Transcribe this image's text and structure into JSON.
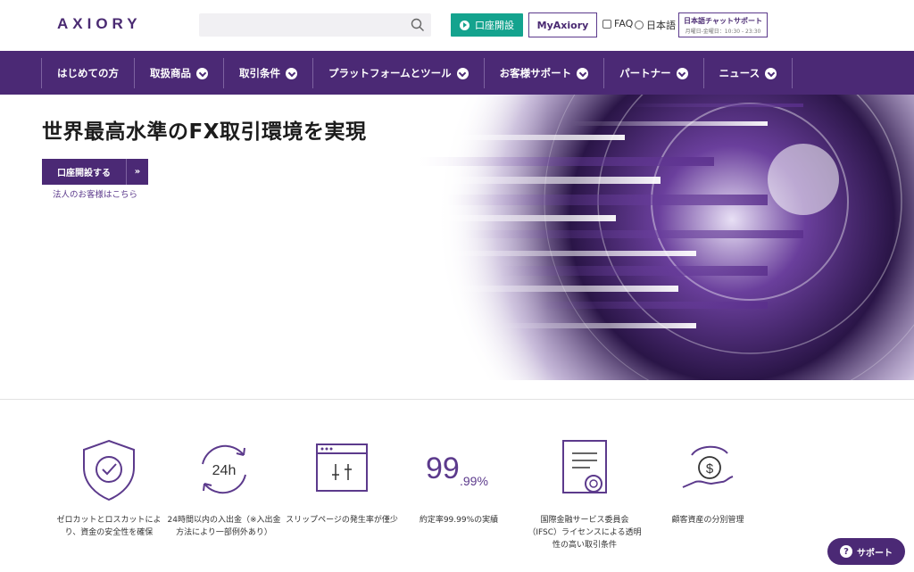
{
  "header": {
    "logo": "AXIORY",
    "search_placeholder": "",
    "open_account": "口座開設",
    "myaxiory": "MyAxiory",
    "faq": "FAQ",
    "language": "日本語",
    "chat_title": "日本語チャットサポート",
    "chat_hours": "月曜日-金曜日：10:30 - 23:30"
  },
  "nav": {
    "items": [
      {
        "label": "はじめての方"
      },
      {
        "label": "取扱商品"
      },
      {
        "label": "取引条件"
      },
      {
        "label": "プラットフォームとツール"
      },
      {
        "label": "お客様サポート"
      },
      {
        "label": "パートナー"
      },
      {
        "label": "ニュース"
      }
    ]
  },
  "hero": {
    "headline": "世界最高水準のFX取引環境を実現",
    "cta": "口座開設する",
    "cta_arrow": "»",
    "corporate_link": "法人のお客様はこちら"
  },
  "features": [
    {
      "icon": "shield-check-icon",
      "caption": "ゼロカットとロスカットにより、資金の安全性を確保"
    },
    {
      "icon": "24h-clock-icon",
      "icon_text": "24h",
      "caption": "24時間以内の入出金（※入出金方法により一部例外あり）"
    },
    {
      "icon": "browser-sliders-icon",
      "caption": "スリップページの発生率が僅少"
    },
    {
      "icon": "percentage-icon",
      "icon_text_big": "99",
      "icon_text_small": ".99%",
      "caption": "約定率99.99%の実績"
    },
    {
      "icon": "certificate-icon",
      "caption": "国際金融サービス委員会（IFSC）ライセンスによる透明性の高い取引条件"
    },
    {
      "icon": "hand-coin-icon",
      "caption": "顧客資産の分別管理"
    }
  ],
  "support_button": "サポート",
  "colors": {
    "brand": "#4b2975",
    "accent": "#14a38e"
  }
}
